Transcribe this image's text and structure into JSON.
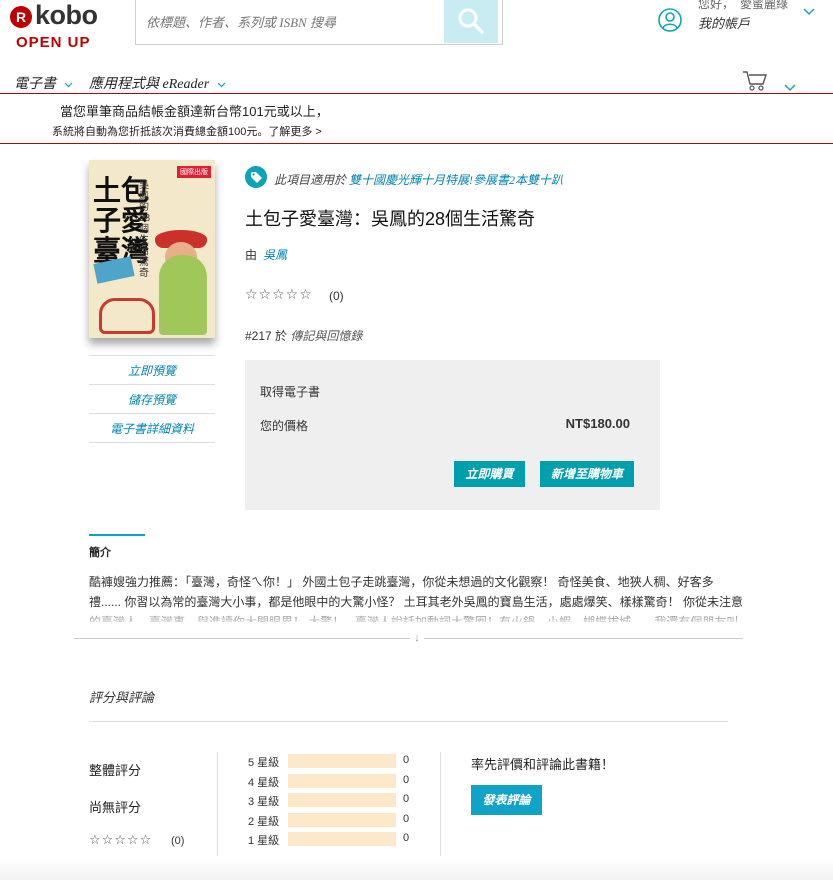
{
  "brand": {
    "mark": "R",
    "word": "kobo",
    "tagline": "OPEN UP",
    "color": "#bf0000"
  },
  "search": {
    "placeholder": "依標題、作者、系列或 ISBN 搜尋",
    "value": ""
  },
  "account": {
    "greeting": "您好，　愛蜜麗綠",
    "label": "我的帳戶"
  },
  "nav": {
    "ebooks": "電子書",
    "apps": "應用程式與 eReader"
  },
  "promo": {
    "line1": "當您單筆商品結帳金額達新台幣101元或以上，",
    "line2": "系統將自動為您折抵該次消費總金額100元。了解更多 >"
  },
  "book": {
    "promo_prefix": "此項目適用於",
    "promo_link": "雙十國慶光輝十月特展!參展書2本雙十趴",
    "title": "土包子愛臺灣：吳鳳的28個生活驚奇",
    "author_prefix": "由",
    "author": "吳鳳",
    "stars": "☆☆☆☆☆",
    "rating_count": "(0)",
    "rank_prefix": "#217 於",
    "rank_category": "傳記與回憶錄",
    "cover": {
      "title": "土包子愛臺灣",
      "subtitle": "吳鳳的28個生活驚奇",
      "badge": "國際出版"
    }
  },
  "side_links": {
    "preview": "立即預覽",
    "save_preview": "儲存預覽",
    "details": "電子書詳細資料"
  },
  "buy": {
    "label": "取得電子書",
    "price_label": "您的價格",
    "price": "NT$180.00",
    "buy_now": "立即購買",
    "add_cart": "新增至購物車"
  },
  "intro": {
    "heading": "簡介",
    "text": "酷褲嫂強力推薦：「臺灣，奇怪ㄟ你！」 外國土包子走跳臺灣，你從未想過的文化觀察！ 奇怪美食、地狹人稠、好客多禮...... 你習以為常的臺灣大小事，都是他眼中的大驚小怪？ 土耳其老外吳鳳的寶島生活，處處爆笑、樣樣驚奇！ 你從未注意的臺灣人、臺灣事，與進讀你大開眼界！ 大驚！ - 臺灣人說話加動詞大驚圈！有火鍋、小蝦、蝴蝶拔城...... 我還有個朋友叫"
  },
  "reviews": {
    "title": "評分與評論",
    "overall": "整體評分",
    "no_rating": "尚無評分",
    "stars": "☆☆☆☆☆",
    "count": "(0)",
    "bars": [
      {
        "label": "5 星級",
        "count": "0",
        "fill": 0
      },
      {
        "label": "4 星級",
        "count": "0",
        "fill": 0
      },
      {
        "label": "3 星級",
        "count": "0",
        "fill": 0
      },
      {
        "label": "2 星級",
        "count": "0",
        "fill": 0
      },
      {
        "label": "1 星級",
        "count": "0",
        "fill": 0
      }
    ],
    "first_prompt": "率先評價和評論此書籍！",
    "post_button": "發表評論"
  }
}
